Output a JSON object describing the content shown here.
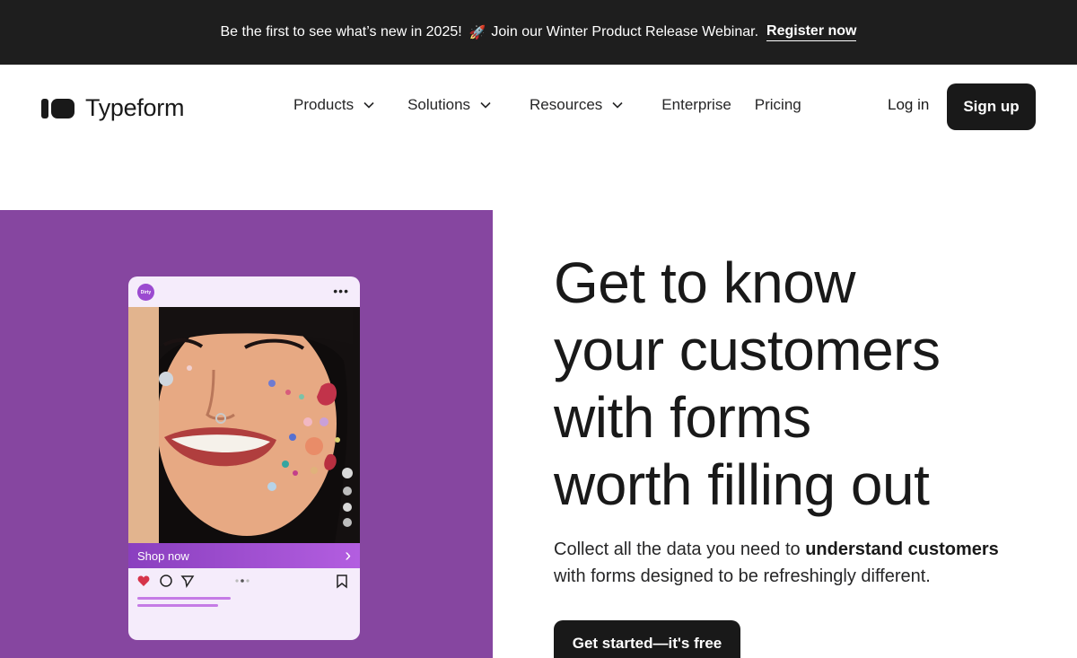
{
  "announcement": {
    "text": "Be the first to see what’s new in 2025!",
    "rocket": "🚀",
    "text2": "Join our Winter Product Release Webinar.",
    "link": "Register now"
  },
  "nav": {
    "logo_text": "Typeform",
    "items": [
      {
        "label": "Products",
        "has_dropdown": true
      },
      {
        "label": "Solutions",
        "has_dropdown": true
      },
      {
        "label": "Resources",
        "has_dropdown": true
      },
      {
        "label": "Enterprise",
        "has_dropdown": false
      },
      {
        "label": "Pricing",
        "has_dropdown": false
      }
    ],
    "login": "Log in",
    "signup": "Sign up"
  },
  "hero": {
    "panel_color": "#8646a0",
    "headline_lines": [
      "Get to know",
      "your customers",
      "with forms",
      "worth filling out"
    ],
    "sub_pre": "Collect all the data you need to ",
    "sub_bold": "understand customers",
    "sub_post": "with forms designed to be refreshingly different.",
    "cta": "Get started—it's free",
    "phone": {
      "brand_badge": "Dirty",
      "menu_dots": "•••",
      "shop_label": "Shop now",
      "shop_chevron": "›"
    }
  }
}
